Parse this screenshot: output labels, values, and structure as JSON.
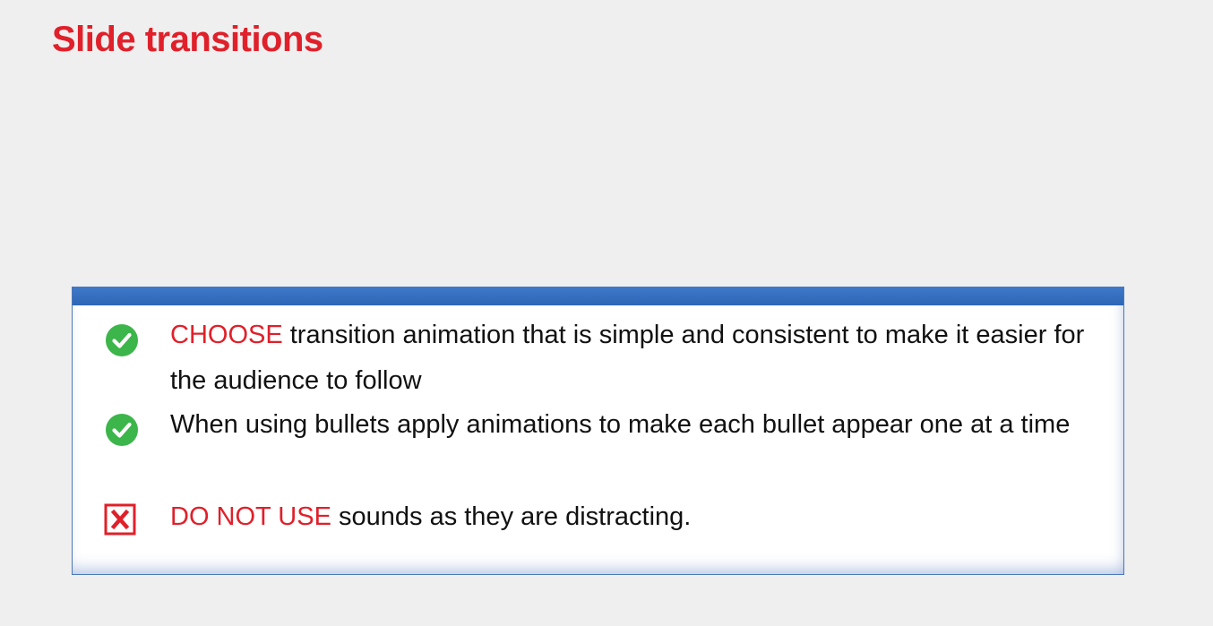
{
  "slide": {
    "title": "Slide transitions"
  },
  "colors": {
    "accent": "#e0202a",
    "check_green": "#3cb54a",
    "box_border": "#4a78b8",
    "box_bar": "#2e66b6"
  },
  "bullets": [
    {
      "icon": "check-circle-icon",
      "emphasis": "CHOOSE",
      "text": " transition animation that is simple and consistent to make it easier for the audience to follow"
    },
    {
      "icon": "check-circle-icon",
      "emphasis": "",
      "text": "When using bullets apply animations to make each bullet appear one at a time"
    },
    {
      "icon": "x-box-icon",
      "emphasis": "DO NOT USE",
      "text": " sounds as they are distracting."
    }
  ]
}
